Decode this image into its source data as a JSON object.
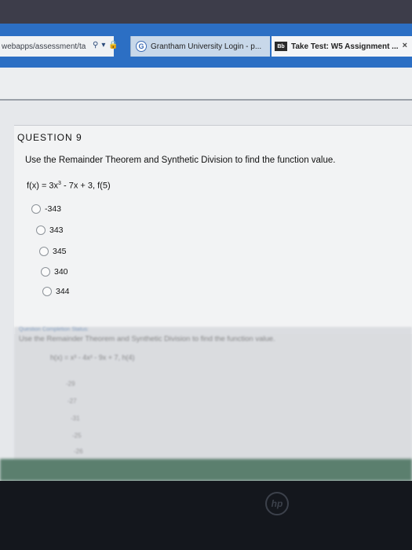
{
  "browser": {
    "address_text": "webapps/assessment/ta",
    "tabs": [
      {
        "label": "Grantham University Login - p...",
        "icon": "google-g-icon"
      },
      {
        "label": "Take Test: W5 Assignment ...",
        "icon": "blackboard-icon",
        "icon_text": "Bb"
      }
    ],
    "close_glyph": "×"
  },
  "question": {
    "heading": "QUESTION 9",
    "prompt": "Use the Remainder Theorem and Synthetic Division to find the function value.",
    "formula_lhs": "f(x) = 3x",
    "formula_exp": "3",
    "formula_rhs": " - 7x + 3, f(5)",
    "options": [
      "-343",
      "343",
      "345",
      "340",
      "344"
    ]
  },
  "next_question": {
    "status": "Question Completion Status:",
    "prompt": "Use the Remainder Theorem and Synthetic Division to find the function value.",
    "formula": "h(x) = x³ - 4x² - 9x + 7, h(4)",
    "options": [
      "-29",
      "-27",
      "-31",
      "-25",
      "-26"
    ]
  },
  "monitor": {
    "logo": "hp"
  }
}
